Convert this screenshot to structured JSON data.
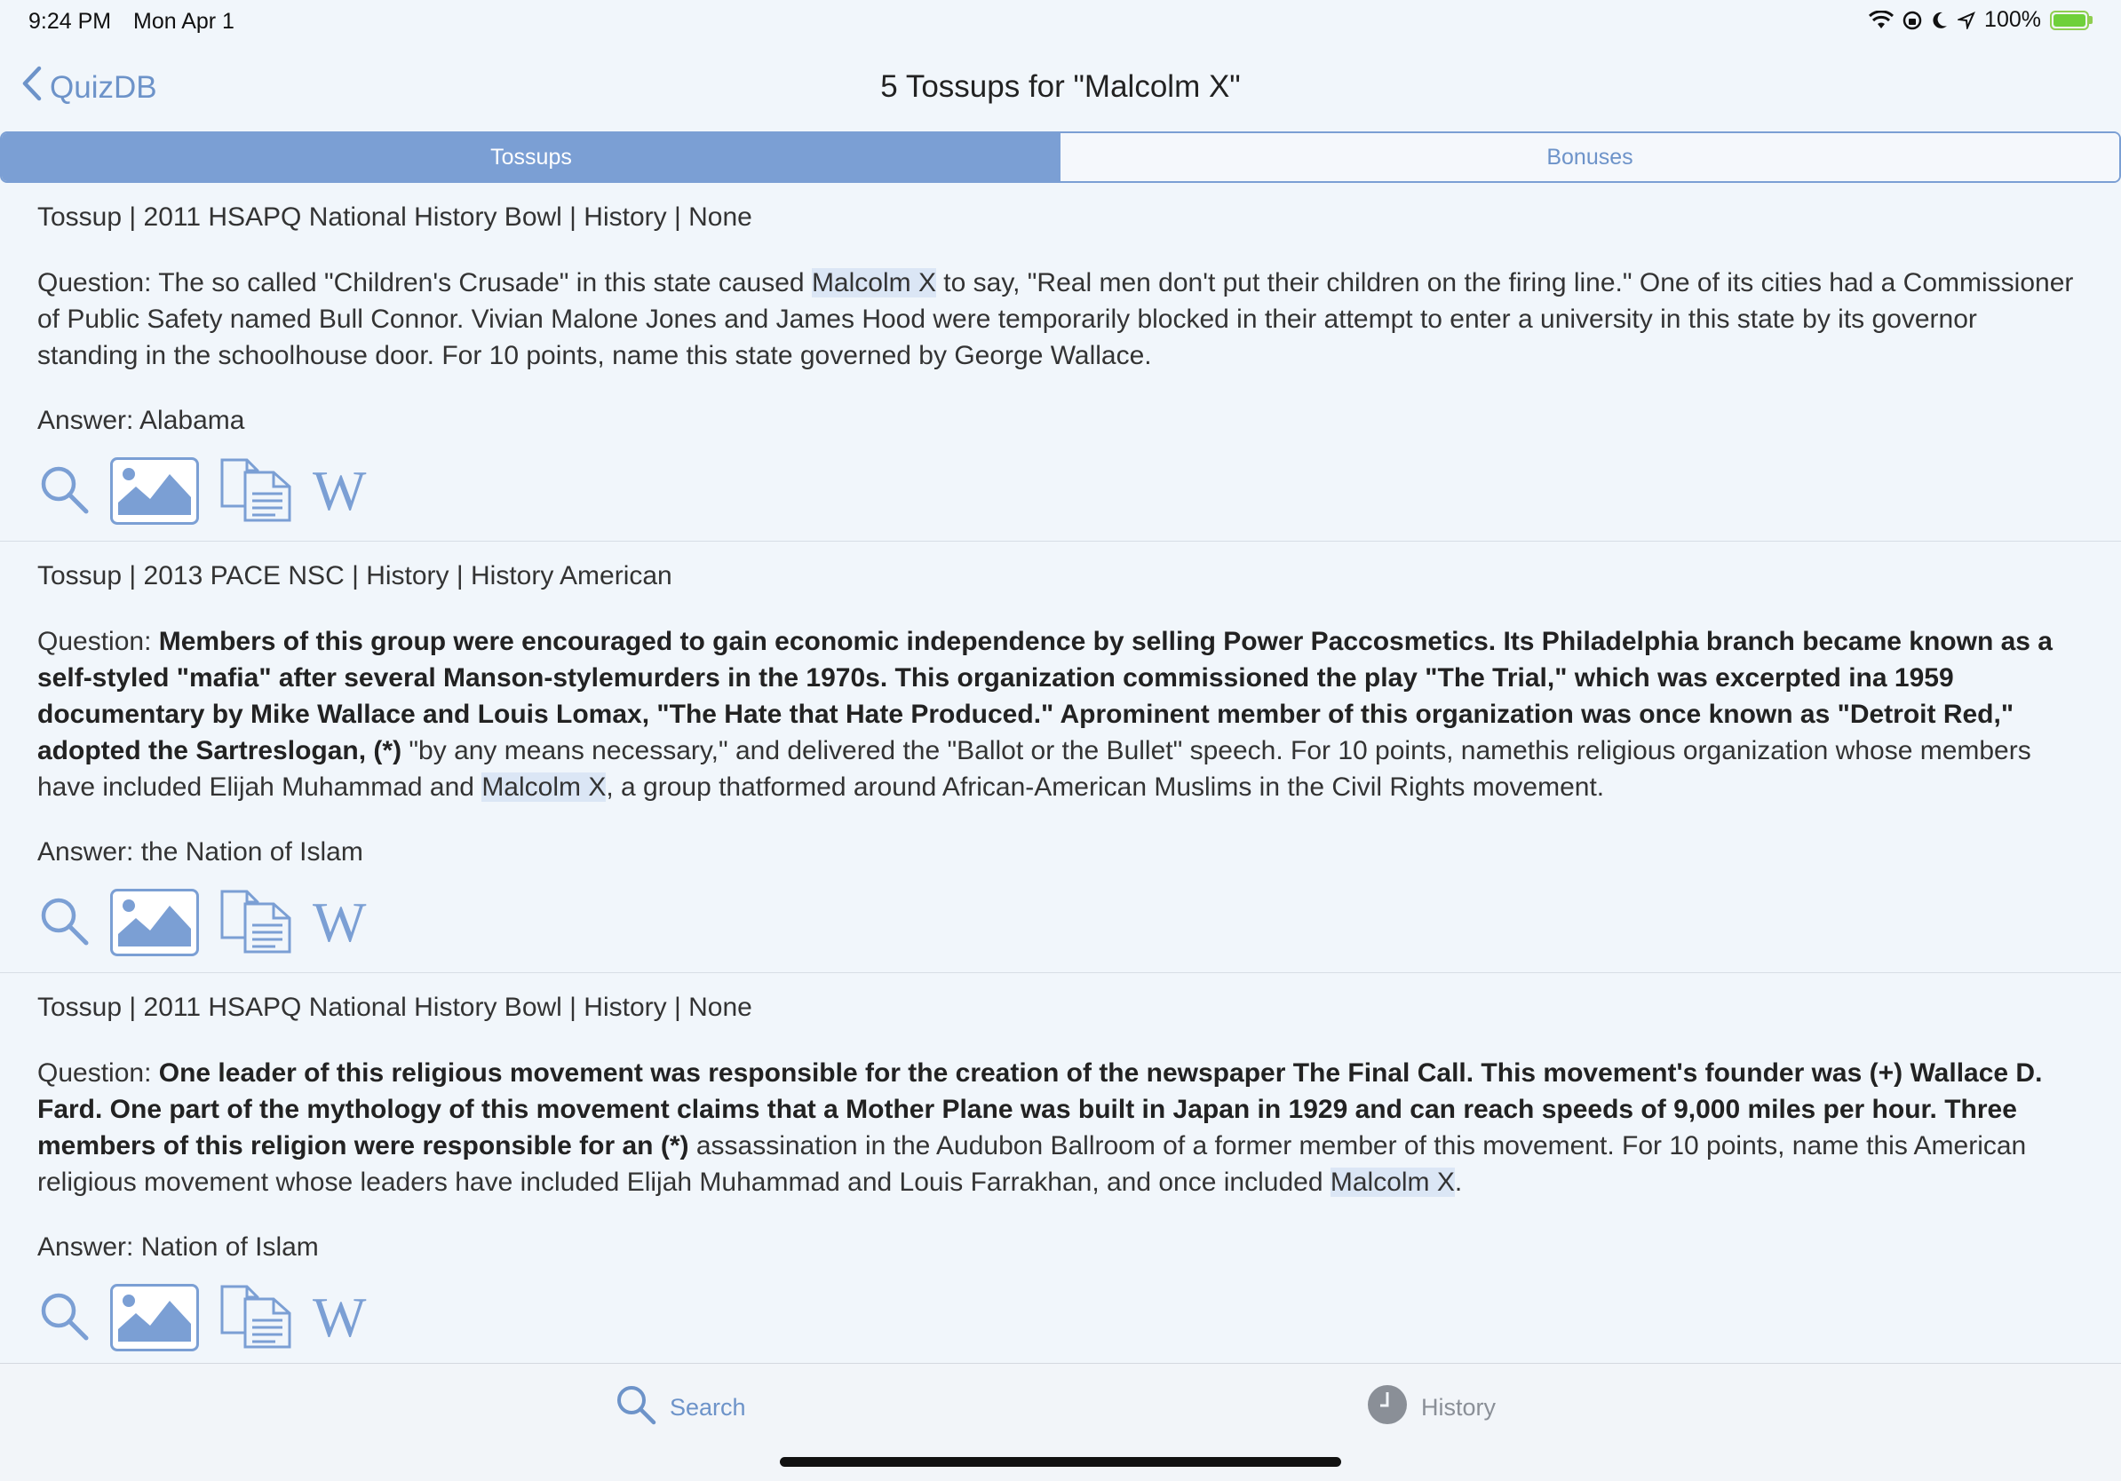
{
  "status": {
    "time": "9:24 PM",
    "date": "Mon Apr 1",
    "battery": "100%"
  },
  "nav": {
    "back_label": "QuizDB",
    "title": "5 Tossups for \"Malcolm X\""
  },
  "segments": {
    "tossups": "Tossups",
    "bonuses": "Bonuses"
  },
  "items": [
    {
      "meta": "Tossup | 2011 HSAPQ National History Bowl | History | None",
      "q_label": "Question: ",
      "q_bold": "",
      "q_text1": "The so called \"Children's Crusade\" in this state caused ",
      "q_hl": "Malcolm X",
      "q_text2": " to say, \"Real men don't put their children on the firing line.\" One of its cities had a Commissioner of Public Safety named Bull Connor. Vivian Malone Jones and James Hood were temporarily blocked in their attempt to enter a university in this state by its governor standing in the schoolhouse door. For 10 points, name this state governed by George Wallace.",
      "answer": "Answer: Alabama"
    },
    {
      "meta": "Tossup | 2013 PACE NSC | History | History American",
      "q_label": "Question: ",
      "q_bold": "Members of this group were encouraged to gain economic independence by selling Power Paccosmetics. Its Philadelphia branch became known as a self-styled \"mafia\" after several Manson-stylemurders in the 1970s. This organization commissioned the play \"The Trial,\" which was excerpted ina 1959 documentary by Mike Wallace and Louis Lomax, \"The Hate that Hate Produced.\" Aprominent member of this organization was once known as \"Detroit Red,\" adopted the Sartreslogan, (*)",
      "q_text1": " \"by any means necessary,\" and delivered the \"Ballot or the Bullet\" speech. For 10 points, namethis religious organization whose members have included Elijah Muhammad and ",
      "q_hl": "Malcolm X",
      "q_text2": ", a group thatformed around African-American Muslims in the Civil Rights movement.",
      "answer": "Answer: the Nation of Islam"
    },
    {
      "meta": "Tossup | 2011 HSAPQ National History Bowl | History | None",
      "q_label": "Question: ",
      "q_bold": "One leader of this religious movement was responsible for the creation of the newspaper The Final Call. This movement's founder was (+) Wallace D. Fard. One part of the mythology of this movement claims that a Mother Plane was built in Japan in 1929 and can reach speeds of 9,000 miles per hour. Three members of this religion were responsible for an (*)",
      "q_text1": " assassination in the Audubon Ballroom of a former member of this movement. For 10 points, name this American religious movement whose leaders have included Elijah Muhammad and Louis Farrakhan, and once included ",
      "q_hl": "Malcolm X",
      "q_text2": ".",
      "answer": "Answer: Nation of Islam"
    }
  ],
  "tabbar": {
    "search": "Search",
    "history": "History"
  },
  "colors": {
    "accent": "#7b9fd4",
    "link": "#6d93c9",
    "highlight": "#dbe6f5",
    "background": "#f1f6fb"
  }
}
